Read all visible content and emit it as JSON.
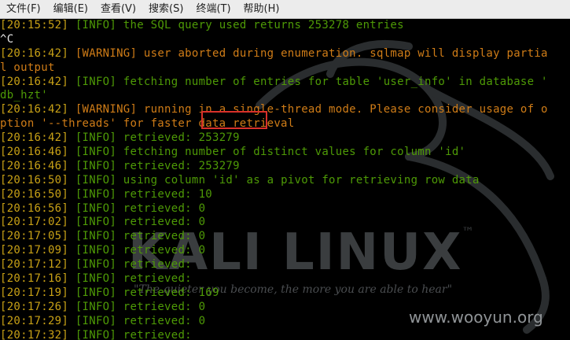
{
  "menubar": {
    "items": [
      "文件(F)",
      "编辑(E)",
      "查看(V)",
      "搜索(S)",
      "终端(T)",
      "帮助(H)"
    ]
  },
  "watermark": {
    "logo": "KALI LINUX",
    "tm": "™",
    "tagline": "\"The quieter you become, the more you are able to hear\"",
    "site": "www.wooyun.org"
  },
  "terminal": {
    "lines": [
      {
        "ts": "[20:15:52]",
        "lvl": "[INFO]",
        "msg": "the SQL query used returns 253278 entries",
        "kind": "info"
      },
      {
        "plain": "^C"
      },
      {
        "ts": "[20:16:42]",
        "lvl": "[WARNING]",
        "msg": "user aborted during enumeration. sqlmap will display partia",
        "kind": "warn"
      },
      {
        "plain": "l output",
        "kind": "warncont"
      },
      {
        "ts": "[20:16:42]",
        "lvl": "[INFO]",
        "msg": "fetching number of entries for table 'user_info' in database '",
        "kind": "info"
      },
      {
        "plain": "db_hzt'",
        "kind": "infocont"
      },
      {
        "ts": "[20:16:42]",
        "lvl": "[WARNING]",
        "msg": "running in a single-thread mode. Please consider usage of o",
        "kind": "warn"
      },
      {
        "plain": "ption '--threads' for faster data retrieval",
        "kind": "warncont"
      },
      {
        "ts": "[20:16:42]",
        "lvl": "[INFO]",
        "msg": "retrieved: 253279",
        "kind": "info"
      },
      {
        "ts": "[20:16:46]",
        "lvl": "[INFO]",
        "msg": "fetching number of distinct values for column 'id'",
        "kind": "info"
      },
      {
        "ts": "[20:16:46]",
        "lvl": "[INFO]",
        "msg": "retrieved: 253279",
        "kind": "info"
      },
      {
        "ts": "[20:16:50]",
        "lvl": "[INFO]",
        "msg": "using column 'id' as a pivot for retrieving row data",
        "kind": "info"
      },
      {
        "ts": "[20:16:50]",
        "lvl": "[INFO]",
        "msg": "retrieved: 10",
        "kind": "info"
      },
      {
        "ts": "[20:16:56]",
        "lvl": "[INFO]",
        "msg": "retrieved: 0",
        "kind": "info"
      },
      {
        "ts": "[20:17:02]",
        "lvl": "[INFO]",
        "msg": "retrieved: 0",
        "kind": "info"
      },
      {
        "ts": "[20:17:05]",
        "lvl": "[INFO]",
        "msg": "retrieved: 0",
        "kind": "info"
      },
      {
        "ts": "[20:17:09]",
        "lvl": "[INFO]",
        "msg": "retrieved: 0",
        "kind": "info"
      },
      {
        "ts": "[20:17:12]",
        "lvl": "[INFO]",
        "msg": "retrieved:",
        "kind": "info"
      },
      {
        "ts": "[20:17:16]",
        "lvl": "[INFO]",
        "msg": "retrieved:",
        "kind": "info"
      },
      {
        "ts": "[20:17:19]",
        "lvl": "[INFO]",
        "msg": "retrieved: 169",
        "kind": "info"
      },
      {
        "ts": "[20:17:26]",
        "lvl": "[INFO]",
        "msg": "retrieved: 0",
        "kind": "info"
      },
      {
        "ts": "[20:17:29]",
        "lvl": "[INFO]",
        "msg": "retrieved: 0",
        "kind": "info"
      },
      {
        "ts": "[20:17:32]",
        "lvl": "[INFO]",
        "msg": "retrieved:",
        "kind": "info"
      }
    ]
  },
  "colors": {
    "timestamp": "#c8a116",
    "info": "#4e9a06",
    "warning": "#cf7c17",
    "highlight_box": "#d9302a"
  }
}
